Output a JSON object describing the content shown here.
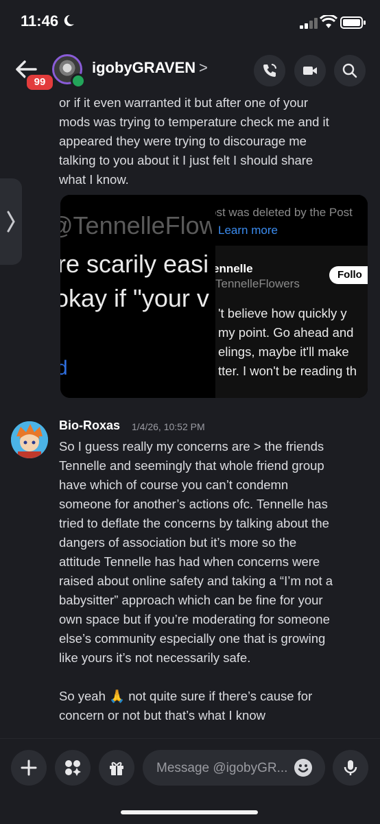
{
  "status": {
    "time": "11:46"
  },
  "header": {
    "username": "igobyGRAVEN",
    "chevron": ">",
    "unread_badge": "99"
  },
  "messages": [
    {
      "lines": [
        "or if it even warranted it but after one of your",
        "mods was trying to temperature check me and it",
        "appeared they were trying to discourage me",
        "talking to you about it I just felt I should share",
        "what I know."
      ],
      "attachments": {
        "left_image": {
          "lines": [
            "@TennelleFlow",
            "re scarily easi",
            "okay if \"your v"
          ],
          "fragment": "d"
        },
        "right_image": {
          "deleted_notice": "ost was deleted by the Post",
          "learn_more": "Learn more",
          "account_name": "ennelle",
          "account_handle": "TennelleFlowers",
          "follow": "Follo",
          "tweet_lines": [
            "'t believe how quickly y",
            "my point. Go ahead and",
            "elings, maybe it'll make",
            "tter. I won't be reading th"
          ]
        }
      }
    },
    {
      "author": "Bio-Roxas",
      "timestamp": "1/4/26, 10:52 PM",
      "paragraph1": [
        "So I guess really my concerns are > the friends",
        "Tennelle and seemingly that whole friend group",
        "have which of course you can’t condemn",
        "someone for another’s actions ofc. Tennelle has",
        "tried to deflate the concerns by talking about the",
        "dangers of association but it’s more so the",
        "attitude Tennelle has had when concerns were",
        "raised about online safety and taking a “I’m not a",
        "babysitter” approach which can be fine for your",
        "own space but if you’re moderating for someone",
        "else’s community especially one that is growing",
        "like yours it’s not necessarily safe."
      ],
      "paragraph2": [
        "So yeah 🙏 not quite sure if there’s cause for",
        "concern or not but that’s what I know"
      ]
    }
  ],
  "composer": {
    "placeholder": "Message @igobyGR..."
  },
  "colors": {
    "accent_blue": "#3b8cf0",
    "badge_red": "#e23c3c",
    "online_green": "#23a55a",
    "background": "#1c1d22"
  }
}
